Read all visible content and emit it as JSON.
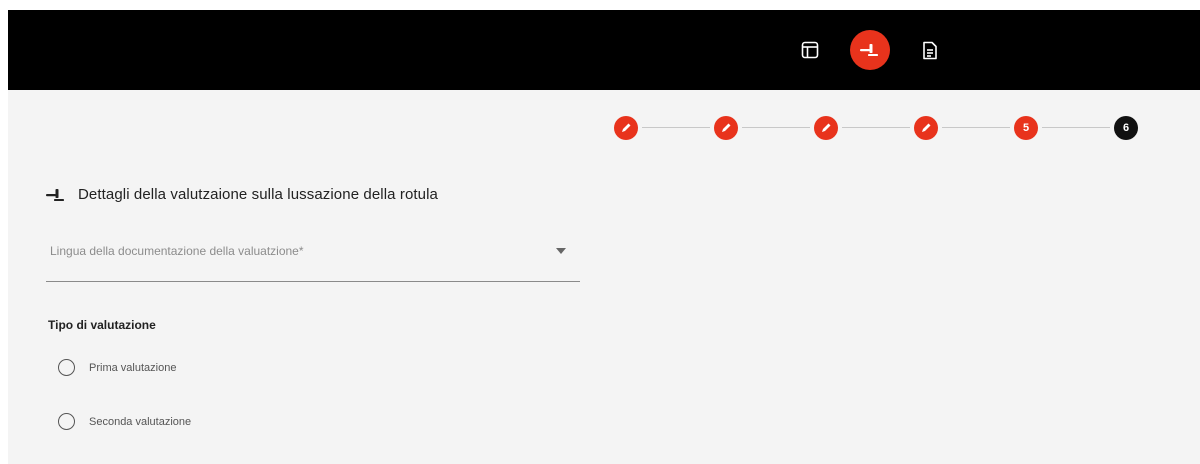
{
  "header": {
    "icons": [
      {
        "name": "layout-icon",
        "active": false
      },
      {
        "name": "gavel-icon",
        "active": true
      },
      {
        "name": "document-icon",
        "active": false
      }
    ]
  },
  "stepper": {
    "steps": [
      {
        "label": "",
        "state": "done",
        "icon": "pencil-icon"
      },
      {
        "label": "",
        "state": "done",
        "icon": "pencil-icon"
      },
      {
        "label": "",
        "state": "done",
        "icon": "pencil-icon"
      },
      {
        "label": "",
        "state": "done",
        "icon": "pencil-icon"
      },
      {
        "label": "5",
        "state": "current"
      },
      {
        "label": "6",
        "state": "pending"
      }
    ]
  },
  "section": {
    "icon": "gavel-icon",
    "title": "Dettagli della valutzaione sulla lussazione della rotula"
  },
  "form": {
    "language_select": {
      "placeholder": "Lingua della documentazione della valuatzione*",
      "value": ""
    },
    "assessment_type": {
      "label": "Tipo di valutazione",
      "options": [
        {
          "label": "Prima valutazione",
          "selected": false
        },
        {
          "label": "Seconda valutazione",
          "selected": false
        }
      ]
    }
  },
  "colors": {
    "accent": "#e8331c",
    "header_bg": "#000000",
    "content_bg": "#f4f4f4",
    "pending_step": "#111111"
  }
}
